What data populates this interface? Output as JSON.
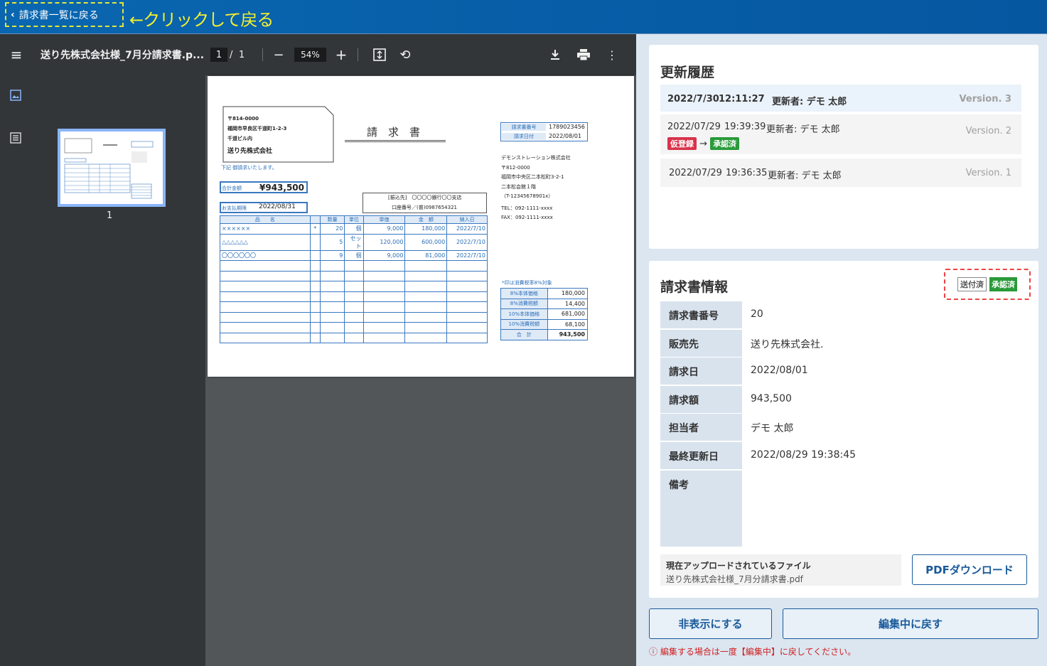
{
  "topbar": {
    "back_label": "請求書一覧に戻る",
    "annotation": "←クリックして戻る"
  },
  "viewer": {
    "file_name": "送り先株式会社様_7月分請求書.p...",
    "page_current": "1",
    "page_sep": "/",
    "page_total": "1",
    "zoom": "54%",
    "thumb_page": "1"
  },
  "invoice": {
    "postal": "〒814-0000",
    "addr1": "福岡市早良区千道町1-2-3",
    "addr2": "千道ビル内",
    "to": "送り先株式会社",
    "note": "下記 御請求いたします。",
    "doc_title": "請　求　書",
    "no_label": "請求書番号",
    "no_value": "1789023456",
    "date_label": "請求日付",
    "date_value": "2022/08/01",
    "total_label": "合計金額",
    "total_value": "¥943,500",
    "due_label": "お支払期限",
    "due_value": "2022/08/31",
    "bank_line1": "[振込先]　〇〇〇〇銀行〇〇支店",
    "bank_line2": "口座番号／(普)0987654321",
    "issuer": [
      "デモンストレーション株式会社",
      "〒812-0000",
      "福岡市中央区二本松町3-2-1",
      "二本松会館１階",
      "（T-12345678901x）",
      "TEL：092-1111-xxxx",
      "FAX：092-1111-xxxx"
    ],
    "headers": [
      "品　　名",
      "",
      "数量",
      "単位",
      "単価",
      "金　額",
      "納入日"
    ],
    "rows": [
      [
        "××××××",
        "*",
        "20",
        "個",
        "9,000",
        "180,000",
        "2022/7/10"
      ],
      [
        "△△△△△△",
        "",
        "5",
        "セット",
        "120,000",
        "600,000",
        "2022/7/10"
      ],
      [
        "〇〇〇〇〇〇",
        "",
        "9",
        "個",
        "9,000",
        "81,000",
        "2022/7/10"
      ]
    ],
    "tax_note": "*印は消費税率8%対象",
    "totals": [
      [
        "8%本体価格",
        "180,000"
      ],
      [
        "8%消費税額",
        "14,400"
      ],
      [
        "10%本体価格",
        "681,000"
      ],
      [
        "10%消費税額",
        "68,100"
      ],
      [
        "合　計",
        "943,500"
      ]
    ]
  },
  "history": {
    "title": "更新履歴",
    "items": [
      {
        "date": "2022/7/30",
        "time": "12:11:27",
        "editor": "更新者: デモ 太郎",
        "version": "Version. 3"
      },
      {
        "date": "2022/07/29",
        "time": "19:39:39",
        "editor": "更新者: デモ 太郎",
        "version": "Version. 2",
        "from": "仮登録",
        "arrow": "→",
        "to": "承認済"
      },
      {
        "date": "2022/07/29",
        "time": "19:36:35",
        "editor": "更新者: デモ 太郎",
        "version": "Version. 1"
      }
    ]
  },
  "info": {
    "title": "請求書情報",
    "badge_sent": "送付済",
    "badge_approved": "承認済",
    "fields": [
      {
        "label": "請求書番号",
        "value": "20"
      },
      {
        "label": "販売先",
        "value": "送り先株式会社."
      },
      {
        "label": "請求日",
        "value": "2022/08/01"
      },
      {
        "label": "請求額",
        "value": "943,500"
      },
      {
        "label": "担当者",
        "value": "デモ 太郎"
      },
      {
        "label": "最終更新日",
        "value": "2022/08/29 19:38:45"
      },
      {
        "label": "備考",
        "value": ""
      }
    ],
    "file_label": "現在アップロードされているファイル",
    "file_name": "送り先株式会社様_7月分請求書.pdf",
    "download_label": "PDFダウンロード"
  },
  "actions": {
    "hide_label": "非表示にする",
    "revert_label": "編集中に戻す",
    "note": "ⓘ 編集する場合は一度【編集中】に戻してください。"
  },
  "colors": {
    "topbar": "#0a66b0",
    "accent": "#1a5a9a",
    "approved": "#2a9a3a",
    "provisional": "#d9324a"
  }
}
